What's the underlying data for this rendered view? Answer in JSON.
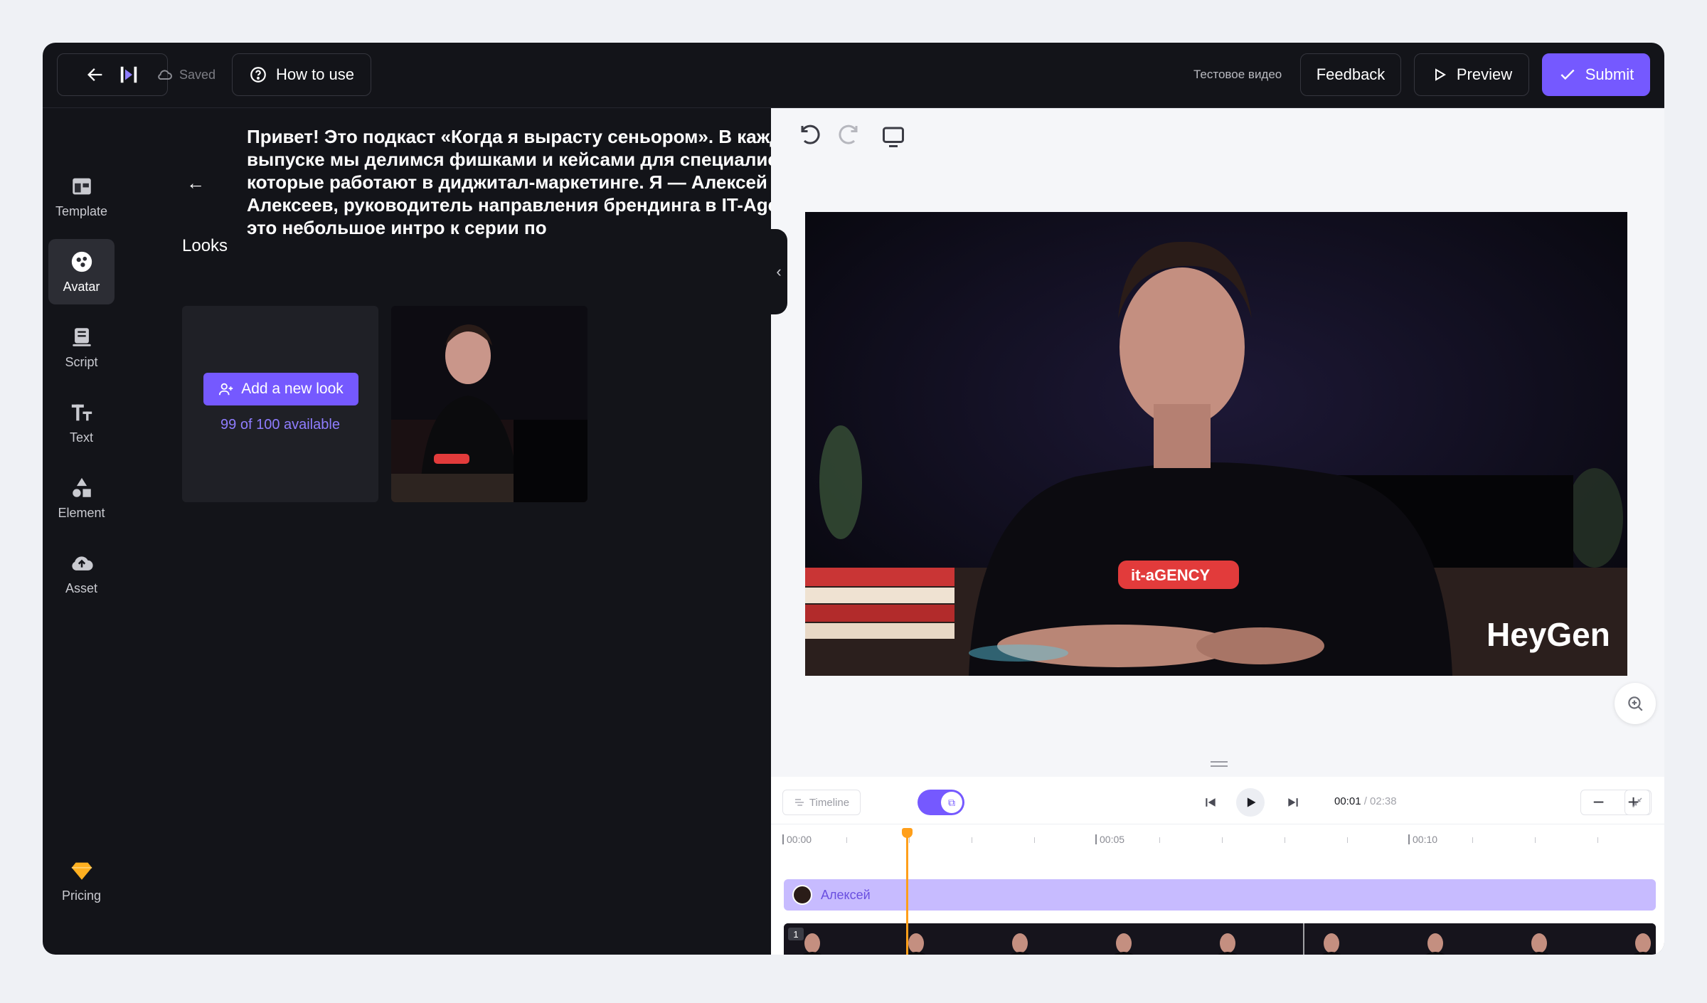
{
  "topbar": {
    "saved_label": "Saved",
    "how_to_use_label": "How to use",
    "test_video_label": "Тестовое видео",
    "feedback_label": "Feedback",
    "preview_label": "Preview",
    "submit_label": "Submit"
  },
  "rail": {
    "items": [
      {
        "label": "Template",
        "icon": "template-icon"
      },
      {
        "label": "Avatar",
        "icon": "avatar-icon"
      },
      {
        "label": "Script",
        "icon": "script-icon"
      },
      {
        "label": "Text",
        "icon": "text-icon"
      },
      {
        "label": "Element",
        "icon": "element-icon"
      },
      {
        "label": "Asset",
        "icon": "asset-icon"
      }
    ],
    "pricing_label": "Pricing"
  },
  "panel": {
    "script_text": "Привет! Это подкаст «Когда я вырасту сеньором». В каждом выпуске мы делимся фишками и кейсами для специалистов, которые работают в диджитал-маркетинге. Я — Алексей Алексеев, руководитель направления брендинга в IT-Agency. А это небольшое интро к серии по",
    "looks_title": "Looks",
    "add_look_label": "Add a new look",
    "available_label": "99 of 100 available"
  },
  "video": {
    "watermark": "HeyGen",
    "shirt_text": "it-aGENCY"
  },
  "timeline": {
    "tab_label": "Timeline",
    "current_time": "00:01",
    "total_time": " / 02:38",
    "ticks": [
      "00:00",
      "00:05",
      "00:10"
    ],
    "avatar_track_label": "Алексей",
    "video_track_number": "1"
  },
  "colors": {
    "accent": "#7559ff",
    "playhead": "#ff9f1a",
    "dark_bg": "#131419"
  }
}
